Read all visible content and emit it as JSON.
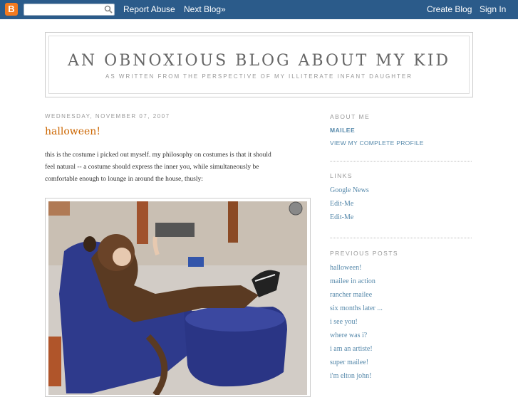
{
  "navbar": {
    "logo_letter": "B",
    "search_placeholder": "",
    "report_abuse": "Report Abuse",
    "next_blog": "Next Blog»",
    "create_blog": "Create Blog",
    "sign_in": "Sign In"
  },
  "header": {
    "title": "AN OBNOXIOUS BLOG ABOUT MY KID",
    "description": "AS WRITTEN FROM THE PERSPECTIVE OF MY ILLITERATE INFANT DAUGHTER"
  },
  "post": {
    "date": "WEDNESDAY, NOVEMBER 07, 2007",
    "title": "halloween!",
    "body_lines": [
      "this is the costume i picked out myself. my philosophy on costumes is that it should",
      "feel natural -- a costume should express the inner you, while simultaneously be",
      "comfortable enough to lounge in around the house, thusly:"
    ]
  },
  "sidebar": {
    "about_heading": "ABOUT ME",
    "profile_name": "MAILEE",
    "profile_link": "VIEW MY COMPLETE PROFILE",
    "links_heading": "LINKS",
    "links": [
      "Google News",
      "Edit-Me",
      "Edit-Me"
    ],
    "previous_heading": "PREVIOUS POSTS",
    "previous_posts": [
      "halloween!",
      "mailee in action",
      "rancher mailee",
      "six months later ...",
      "i see you!",
      "where was i?",
      "i am an artiste!",
      "super mailee!",
      "i'm elton john!"
    ]
  },
  "colors": {
    "navbar": "#2b5b8a",
    "post_title": "#cc6600",
    "link": "#5588aa"
  }
}
